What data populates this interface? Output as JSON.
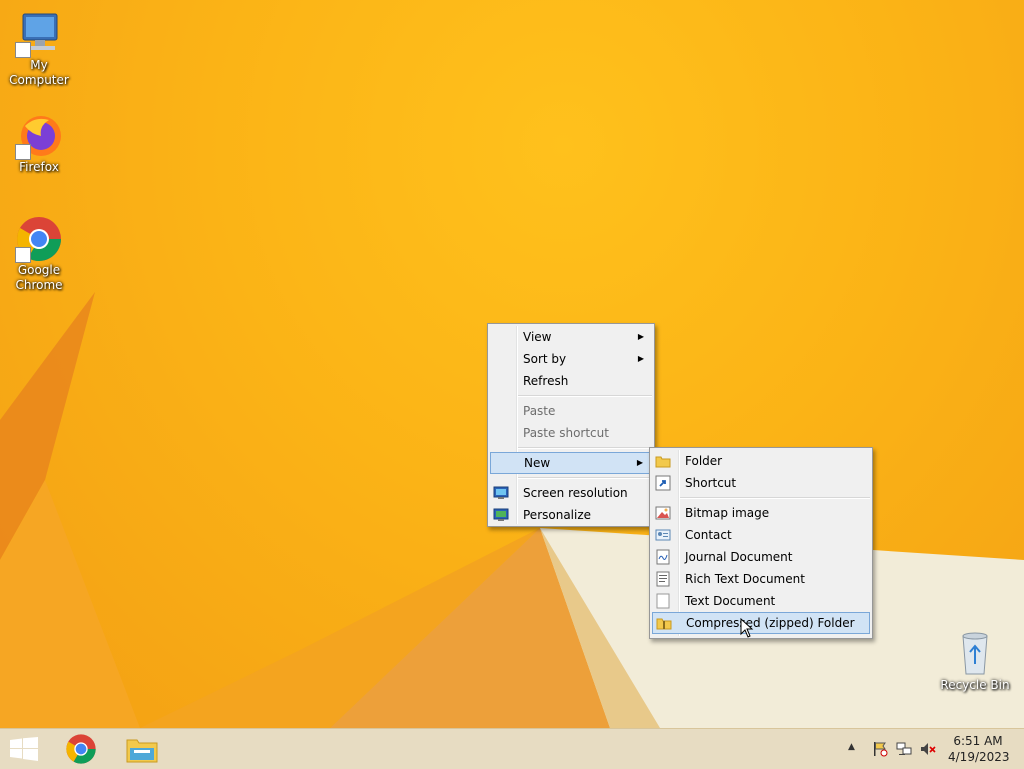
{
  "desktop_icons": [
    {
      "label": "My Computer"
    },
    {
      "label": "Firefox"
    },
    {
      "label": "Google Chrome"
    },
    {
      "label": "Recycle Bin"
    }
  ],
  "context_menu": {
    "view": "View",
    "sort_by": "Sort by",
    "refresh": "Refresh",
    "paste": "Paste",
    "paste_shortcut": "Paste shortcut",
    "new": "New",
    "screen_resolution": "Screen resolution",
    "personalize": "Personalize"
  },
  "new_submenu": {
    "folder": "Folder",
    "shortcut": "Shortcut",
    "bitmap_image": "Bitmap image",
    "contact": "Contact",
    "journal_document": "Journal Document",
    "rich_text_document": "Rich Text Document",
    "text_document": "Text Document",
    "compressed_folder": "Compressed (zipped) Folder"
  },
  "taskbar": {
    "clock_time": "6:51 AM",
    "clock_date": "4/19/2023"
  },
  "colors": {
    "desktop": "#fbb316",
    "menu_bg": "#f0f0f0",
    "menu_highlight": "#d1e3f5",
    "taskbar": "#e7dcc2"
  }
}
